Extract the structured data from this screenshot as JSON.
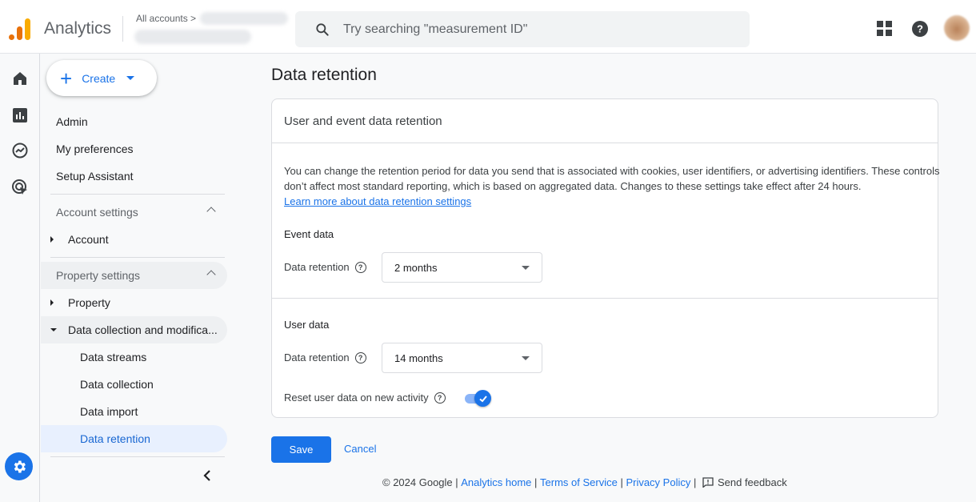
{
  "header": {
    "app_name": "Analytics",
    "breadcrumb_root": "All accounts",
    "breadcrumb_sep": ">",
    "search_placeholder": "Try searching \"measurement ID\""
  },
  "icons": {
    "logo": "analytics-logo",
    "search": "search-icon",
    "apps": "apps-grid-icon",
    "help": "help-icon",
    "rail": [
      "home-icon",
      "reports-icon",
      "explore-icon",
      "advertising-icon"
    ],
    "admin": "gear-icon"
  },
  "sidebar": {
    "create_label": "Create",
    "top_items": [
      "Admin",
      "My preferences",
      "Setup Assistant"
    ],
    "account_settings_label": "Account settings",
    "account_item": "Account",
    "property_settings_label": "Property settings",
    "property_item": "Property",
    "data_collection_item": "Data collection and modifica...",
    "data_sub_items": [
      "Data streams",
      "Data collection",
      "Data import",
      "Data retention"
    ],
    "active_item": "Data retention"
  },
  "main": {
    "page_title": "Data retention",
    "card_title": "User and event data retention",
    "description": "You can change the retention period for data you send that is associated with cookies, user identifiers, or advertising identifiers. These controls don’t affect most standard reporting, which is based on aggregated data. Changes to these settings take effect after 24 hours.",
    "learn_more": "Learn more about data retention settings",
    "event_section": "Event data",
    "event_retention_label": "Data retention",
    "event_retention_value": "2 months",
    "user_section": "User data",
    "user_retention_label": "Data retention",
    "user_retention_value": "14 months",
    "reset_label": "Reset user data on new activity",
    "reset_enabled": true,
    "save_label": "Save",
    "cancel_label": "Cancel"
  },
  "footer": {
    "copyright": "© 2024 Google | ",
    "links": [
      "Analytics home",
      "Terms of Service",
      "Privacy Policy"
    ],
    "sep": " | ",
    "feedback": "Send feedback"
  },
  "colors": {
    "accent": "#1a73e8",
    "logo_orange": "#e8710a",
    "logo_yellow": "#f9ab00",
    "active_bg": "#e8f0fe"
  }
}
